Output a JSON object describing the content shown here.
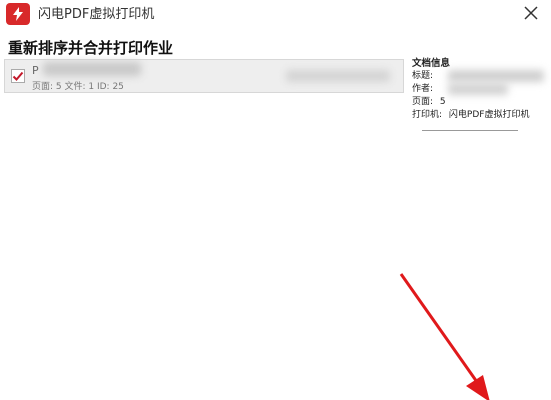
{
  "window": {
    "title": "闪电PDF虚拟打印机",
    "icon": "app-logo-icon",
    "close_icon": "close-icon"
  },
  "heading": "重新排序并合并打印作业",
  "jobs": [
    {
      "checked": true,
      "name": "P",
      "meta": "页面:  5   文件:  1   ID:  25"
    }
  ],
  "doc_info": {
    "header": "文档信息",
    "title_label": "标题:",
    "author_label": "作者:",
    "pages_label": "页面:",
    "pages_value": "5",
    "printer_label": "打印机:",
    "printer_value": "闪电PDF虚拟打印机"
  },
  "colors": {
    "brand": "#d8292a",
    "arrow": "#e0191b",
    "check": "#c3182a"
  }
}
